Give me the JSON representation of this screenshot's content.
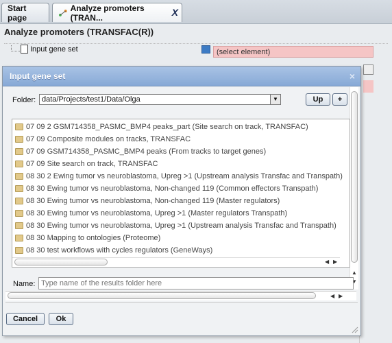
{
  "tabs": [
    {
      "label": "Start page"
    },
    {
      "label": "Analyze promoters (TRAN...",
      "close": "X"
    }
  ],
  "main": {
    "title": "Analyze promoters (TRANSFAC(R))",
    "property_label": "Input gene set",
    "select_placeholder": "(select element)"
  },
  "dialog": {
    "title": "Input gene set",
    "close": "×",
    "folder_label": "Folder:",
    "folder_value": "data/Projects/test1/Data/Olga",
    "up_label": "Up",
    "plus_label": "+",
    "items": [
      "07 09 2 GSM714358_PASMC_BMP4 peaks_part (Site search on track, TRANSFAC)",
      "07 09 Composite modules on tracks, TRANSFAC",
      "07 09 GSM714358_PASMC_BMP4 peaks (From tracks to target genes)",
      "07 09 Site search on track, TRANSFAC",
      "08 30 2 Ewing tumor vs neuroblastoma, Upreg >1 (Upstream analysis Transfac and Transpath)",
      "08 30 Ewing tumor vs neuroblastoma, Non-changed 119 (Common effectors Transpath)",
      "08 30 Ewing tumor vs neuroblastoma, Non-changed 119 (Master regulators)",
      "08 30 Ewing tumor vs neuroblastoma, Upreg >1 (Master regulators Transpath)",
      "08 30 Ewing tumor vs neuroblastoma, Upreg >1 (Upstream analysis Transfac and Transpath)",
      "08 30 Mapping to ontologies (Proteome)",
      "08 30 test workflows with cycles regulators (GeneWays)"
    ],
    "name_label": "Name:",
    "name_placeholder": "Type name of the results folder here",
    "cancel_label": "Cancel",
    "ok_label": "Ok"
  }
}
